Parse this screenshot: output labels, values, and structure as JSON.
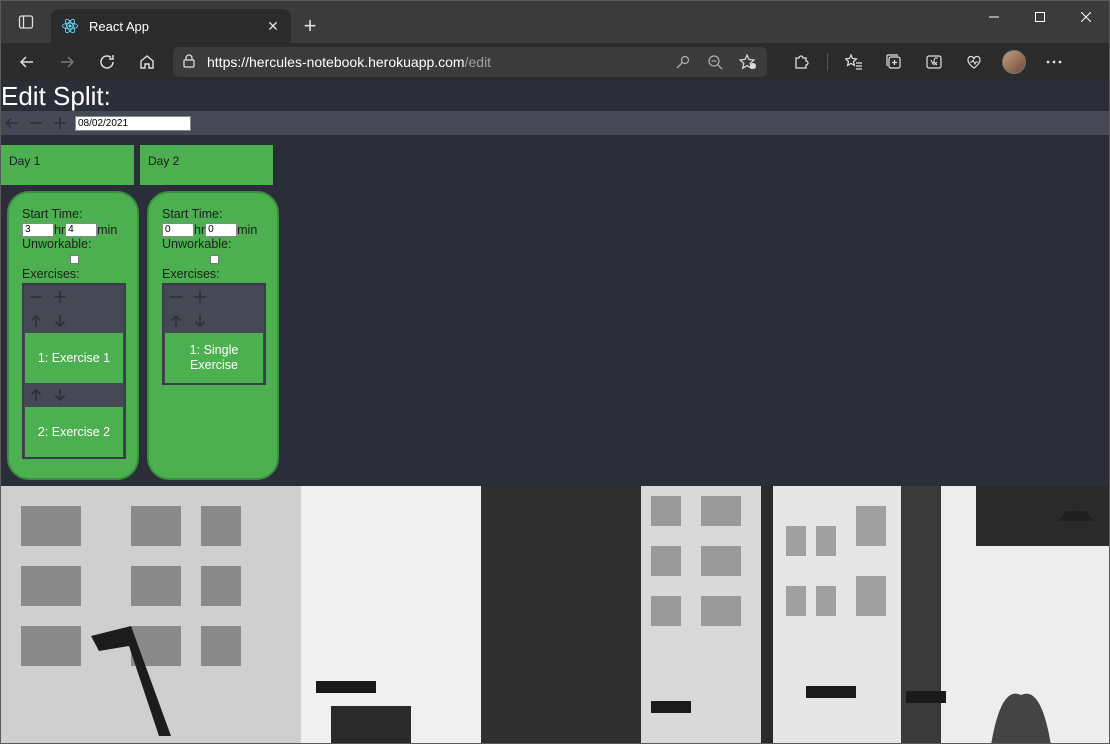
{
  "browser": {
    "tab_title": "React App",
    "url_host": "https://hercules-notebook.herokuapp.com",
    "url_path": "/edit"
  },
  "page": {
    "title": "Edit Split:",
    "date_value": "08/02/2021"
  },
  "days": [
    {
      "tab_label": "Day 1",
      "start_time_label": "Start Time:",
      "hours": "3",
      "hr_unit": "hr",
      "minutes": "4",
      "min_unit": "min",
      "unworkable_label": "Unworkable:",
      "exercises_label": "Exercises:",
      "exercises": [
        "1: Exercise 1",
        "2: Exercise 2"
      ]
    },
    {
      "tab_label": "Day 2",
      "start_time_label": "Start Time:",
      "hours": "0",
      "hr_unit": "hr",
      "minutes": "0",
      "min_unit": "min",
      "unworkable_label": "Unworkable:",
      "exercises_label": "Exercises:",
      "exercises": [
        "1: Single Exercise"
      ]
    }
  ],
  "colors": {
    "page_bg": "#2b2d38",
    "control_bar": "#464856",
    "accent_green": "#4caf50"
  },
  "icons": [
    "back-arrow-icon",
    "minus-icon",
    "plus-icon",
    "arrow-up-icon",
    "arrow-down-icon"
  ]
}
